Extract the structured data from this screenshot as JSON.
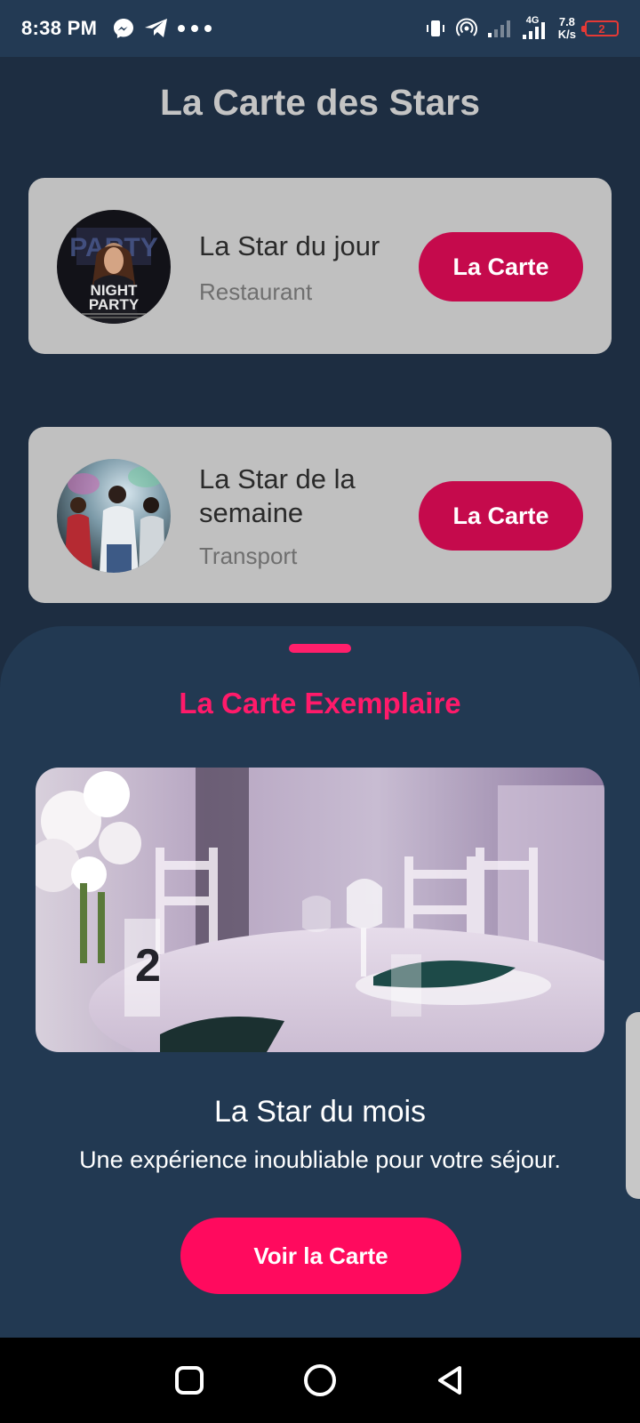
{
  "status_bar": {
    "time": "8:38 PM",
    "net_speed_value": "7.8",
    "net_speed_unit": "K/s",
    "network_type": "4G",
    "battery_level": "2",
    "left_icons": [
      "messenger-icon",
      "telegram-icon",
      "more-dots-icon"
    ],
    "right_icons": [
      "vibrate-icon",
      "hotspot-icon",
      "signal-icon",
      "signal-4g-icon",
      "battery-icon"
    ]
  },
  "header": {
    "title": "La Carte des Stars"
  },
  "cards": [
    {
      "title": "La Star du jour",
      "category": "Restaurant",
      "button_label": "La Carte",
      "image": "night-party-poster"
    },
    {
      "title": "La Star de la semaine",
      "category": "Transport",
      "button_label": "La Carte",
      "image": "dancing-crowd-photo"
    }
  ],
  "sheet": {
    "title": "La Carte Exemplaire",
    "image": "banquet-table-photo",
    "name": "La Star du mois",
    "description": "Une expérience inoubliable pour votre séjour.",
    "button_label": "Voir la Carte"
  },
  "colors": {
    "background": "#1d2d41",
    "status_bar": "#233a54",
    "card": "#c0c0c0",
    "card_button": "#c50a4c",
    "accent": "#ff0a5e",
    "sheet": "#223952"
  },
  "nav": {
    "icons": [
      "recent-apps-icon",
      "home-icon",
      "back-icon"
    ]
  }
}
